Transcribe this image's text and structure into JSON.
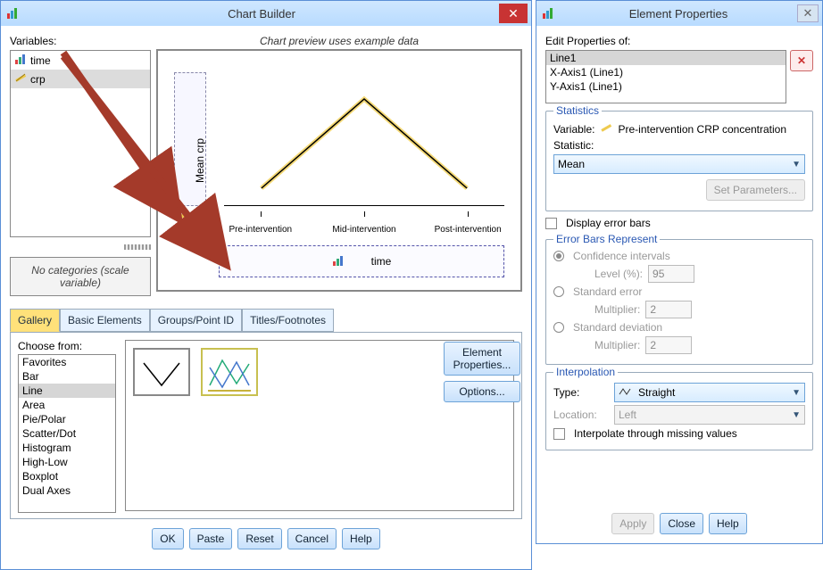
{
  "chart_builder": {
    "title": "Chart Builder",
    "variables_label": "Variables:",
    "variables": [
      {
        "name": "time",
        "icon": "ordinal-icon"
      },
      {
        "name": "crp",
        "icon": "scale-icon"
      }
    ],
    "no_categories": "No categories (scale variable)",
    "preview_title": "Chart preview uses example data",
    "y_drop_label": "Mean  crp",
    "x_drop_label": "time",
    "x_ticks": [
      "Pre-intervention",
      "Mid-intervention",
      "Post-intervention"
    ],
    "tabs": [
      "Gallery",
      "Basic Elements",
      "Groups/Point ID",
      "Titles/Footnotes"
    ],
    "choose_label": "Choose from:",
    "choose_list": [
      "Favorites",
      "Bar",
      "Line",
      "Area",
      "Pie/Polar",
      "Scatter/Dot",
      "Histogram",
      "High-Low",
      "Boxplot",
      "Dual Axes"
    ],
    "choose_selected": "Line",
    "side_buttons": {
      "element_props": "Element Properties...",
      "options": "Options..."
    },
    "bottom_buttons": {
      "ok": "OK",
      "paste": "Paste",
      "reset": "Reset",
      "cancel": "Cancel",
      "help": "Help"
    }
  },
  "element_properties": {
    "title": "Element Properties",
    "edit_label": "Edit Properties of:",
    "elements": [
      "Line1",
      "X-Axis1 (Line1)",
      "Y-Axis1 (Line1)"
    ],
    "selected": "Line1",
    "statistics": {
      "legend": "Statistics",
      "variable_label": "Variable:",
      "variable_value": "Pre-intervention CRP concentration",
      "statistic_label": "Statistic:",
      "statistic_value": "Mean",
      "set_params": "Set Parameters..."
    },
    "display_error_bars_label": "Display error bars",
    "error_bars": {
      "legend": "Error Bars Represent",
      "ci_label": "Confidence intervals",
      "ci_level_label": "Level (%):",
      "ci_level": "95",
      "se_label": "Standard error",
      "se_mult_label": "Multiplier:",
      "se_mult": "2",
      "sd_label": "Standard deviation",
      "sd_mult_label": "Multiplier:",
      "sd_mult": "2"
    },
    "interpolation": {
      "legend": "Interpolation",
      "type_label": "Type:",
      "type_value": "Straight",
      "location_label": "Location:",
      "location_value": "Left",
      "missing_label": "Interpolate through missing values"
    },
    "buttons": {
      "apply": "Apply",
      "close": "Close",
      "help": "Help"
    }
  },
  "chart_data": {
    "type": "line",
    "categories": [
      "Pre-intervention",
      "Mid-intervention",
      "Post-intervention"
    ],
    "series": [
      {
        "name": "Mean crp",
        "values": [
          10,
          60,
          10
        ]
      }
    ],
    "xlabel": "time",
    "ylabel": "Mean crp",
    "title": "",
    "ylim": [
      0,
      70
    ]
  }
}
